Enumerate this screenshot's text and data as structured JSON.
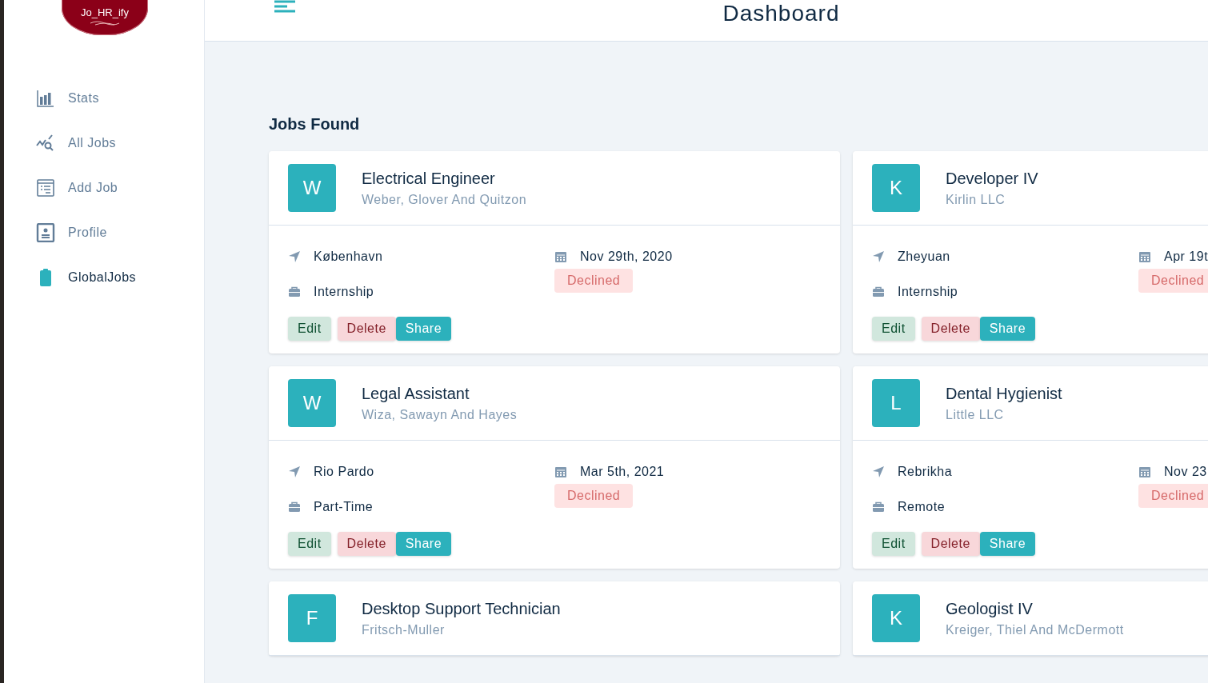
{
  "sidebar": {
    "logo": "Jo_HR_ify",
    "items": [
      {
        "label": "Stats",
        "selected": false
      },
      {
        "label": "All Jobs",
        "selected": false
      },
      {
        "label": "Add Job",
        "selected": false
      },
      {
        "label": "Profile",
        "selected": false
      },
      {
        "label": "GlobalJobs",
        "selected": true
      }
    ]
  },
  "header": {
    "title": "Dashboard"
  },
  "main": {
    "heading": "Jobs Found",
    "jobs": [
      {
        "letter": "W",
        "position": "Electrical Engineer",
        "company": "Weber, Glover And Quitzon",
        "location": "København",
        "date": "Nov 29th, 2020",
        "job_type": "Internship",
        "status": "Declined",
        "kind": "declined",
        "actions": [
          "Edit",
          "Delete",
          "Share"
        ]
      },
      {
        "letter": "K",
        "position": "Developer IV",
        "company": "Kirlin LLC",
        "location": "Zheyuan",
        "date": "Apr 19t",
        "job_type": "Internship",
        "status": "Declined",
        "kind": "declined",
        "actions": [
          "Edit",
          "Delete",
          "Share"
        ]
      },
      {
        "letter": "W",
        "position": "Legal Assistant",
        "company": "Wiza, Sawayn And Hayes",
        "location": "Rio Pardo",
        "date": "Mar 5th, 2021",
        "job_type": "Part-Time",
        "status": "Declined",
        "kind": "declined",
        "actions": [
          "Edit",
          "Delete",
          "Share"
        ]
      },
      {
        "letter": "L",
        "position": "Dental Hygienist",
        "company": "Little LLC",
        "location": "Rebrikha",
        "date": "Nov 23",
        "job_type": "Remote",
        "status": "Declined",
        "kind": "declined",
        "actions": [
          "Edit",
          "Delete",
          "Share"
        ]
      },
      {
        "letter": "F",
        "position": "Desktop Support Technician",
        "company": "Fritsch-Muller"
      },
      {
        "letter": "K",
        "position": "Geologist IV",
        "company": "Kreiger, Thiel And McDermott"
      }
    ]
  }
}
